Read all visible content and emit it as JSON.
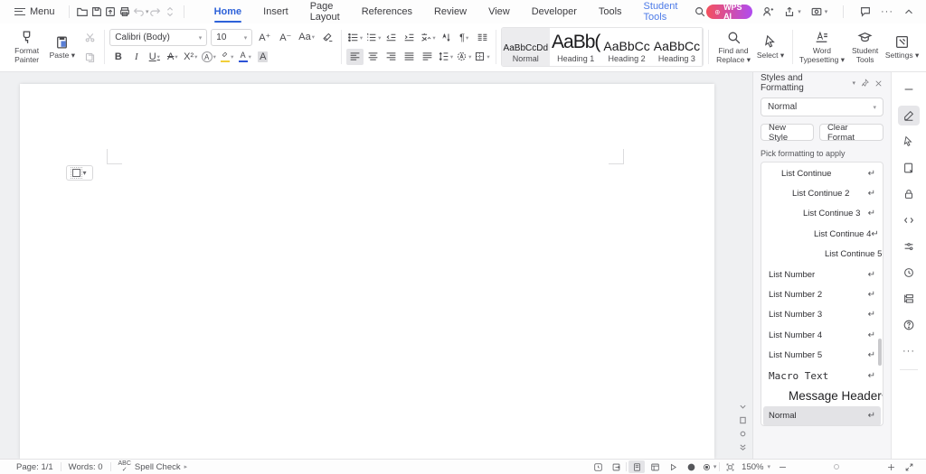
{
  "titlebar": {
    "menu_label": "Menu",
    "quick_icons": [
      "open",
      "save",
      "export",
      "print",
      "undo",
      "redo",
      "more"
    ],
    "tabs": [
      {
        "label": "Home",
        "state": "active"
      },
      {
        "label": "Insert",
        "state": "normal"
      },
      {
        "label": "Page Layout",
        "state": "normal"
      },
      {
        "label": "References",
        "state": "normal"
      },
      {
        "label": "Review",
        "state": "normal"
      },
      {
        "label": "View",
        "state": "normal"
      },
      {
        "label": "Developer",
        "state": "normal"
      },
      {
        "label": "Tools",
        "state": "normal"
      },
      {
        "label": "Student Tools",
        "state": "accent"
      }
    ],
    "wps_ai_label": "WPS AI",
    "accent_color": "#2e62d9",
    "wps_ai_gradient": [
      "#f4505c",
      "#b04cf0"
    ]
  },
  "ribbon": {
    "format_painter": "Format Painter",
    "paste": "Paste",
    "font_name": "Calibri (Body)",
    "font_size": "10",
    "grow_font": "A⁺",
    "shrink_font": "A⁻",
    "change_case": "Aa",
    "bold": "B",
    "italic": "I",
    "underline": "U",
    "strike": "A",
    "superscript": "X²",
    "more_effects": "A",
    "char_shading": "A",
    "styles_gallery": [
      {
        "preview": "AaBbCcDd",
        "label": "Normal",
        "selected": true
      },
      {
        "preview": "AaBb(",
        "label": "Heading 1",
        "selected": false
      },
      {
        "preview": "AaBbCc",
        "label": "Heading 2",
        "selected": false
      },
      {
        "preview": "AaBbCc",
        "label": "Heading 3",
        "selected": false
      }
    ],
    "find_replace": "Find and Replace",
    "select": "Select",
    "word_typesetting": "Word Typesetting",
    "student_tools": "Student Tools",
    "settings": "Settings"
  },
  "panel": {
    "title": "Styles and Formatting",
    "dropdown_value": "Normal",
    "new_style_btn": "New Style",
    "clear_format_btn": "Clear Format",
    "hint": "Pick formatting to apply",
    "styles": [
      {
        "name": "List Continue"
      },
      {
        "name": "List Continue 2"
      },
      {
        "name": "List Continue 3"
      },
      {
        "name": "List Continue 4"
      },
      {
        "name": "List Continue 5"
      },
      {
        "name": "List Number"
      },
      {
        "name": "List Number 2"
      },
      {
        "name": "List Number 3"
      },
      {
        "name": "List Number 4"
      },
      {
        "name": "List Number 5"
      },
      {
        "name": "Macro Text"
      },
      {
        "name": "Message Header"
      },
      {
        "name": "Normal",
        "selected": true
      }
    ],
    "return_mark": "↵"
  },
  "rightbar_icons": [
    "collapse",
    "edit-pen",
    "select-arrow",
    "extract-page",
    "lock",
    "code",
    "adjust",
    "history",
    "structure",
    "help",
    "more"
  ],
  "statusbar": {
    "page": "Page: 1/1",
    "words": "Words: 0",
    "spellcheck": "Spell Check",
    "zoom": "150%"
  }
}
